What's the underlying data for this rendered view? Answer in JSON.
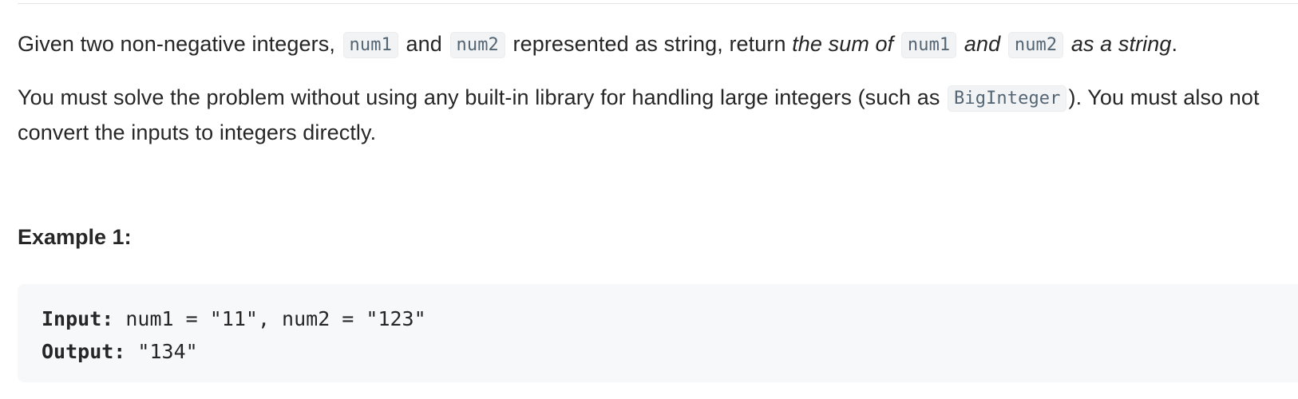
{
  "description": {
    "p1": {
      "t1": "Given two non-negative integers,",
      "c1": "num1",
      "t2": "and",
      "c2": "num2",
      "t3": "represented as string, return",
      "e1": "the sum of",
      "c3": "num1",
      "e2": "and",
      "c4": "num2",
      "e3": "as a string",
      "t4": "."
    },
    "p2": {
      "t1": "You must solve the problem without using any built-in library for handling large integers (such as",
      "c1": "BigInteger",
      "t2": "). You must also not convert the inputs to integers directly."
    }
  },
  "example": {
    "title": "Example 1:",
    "input_label": "Input:",
    "input_value": "num1 = \"11\", num2 = \"123\"",
    "output_label": "Output:",
    "output_value": "\"134\""
  }
}
